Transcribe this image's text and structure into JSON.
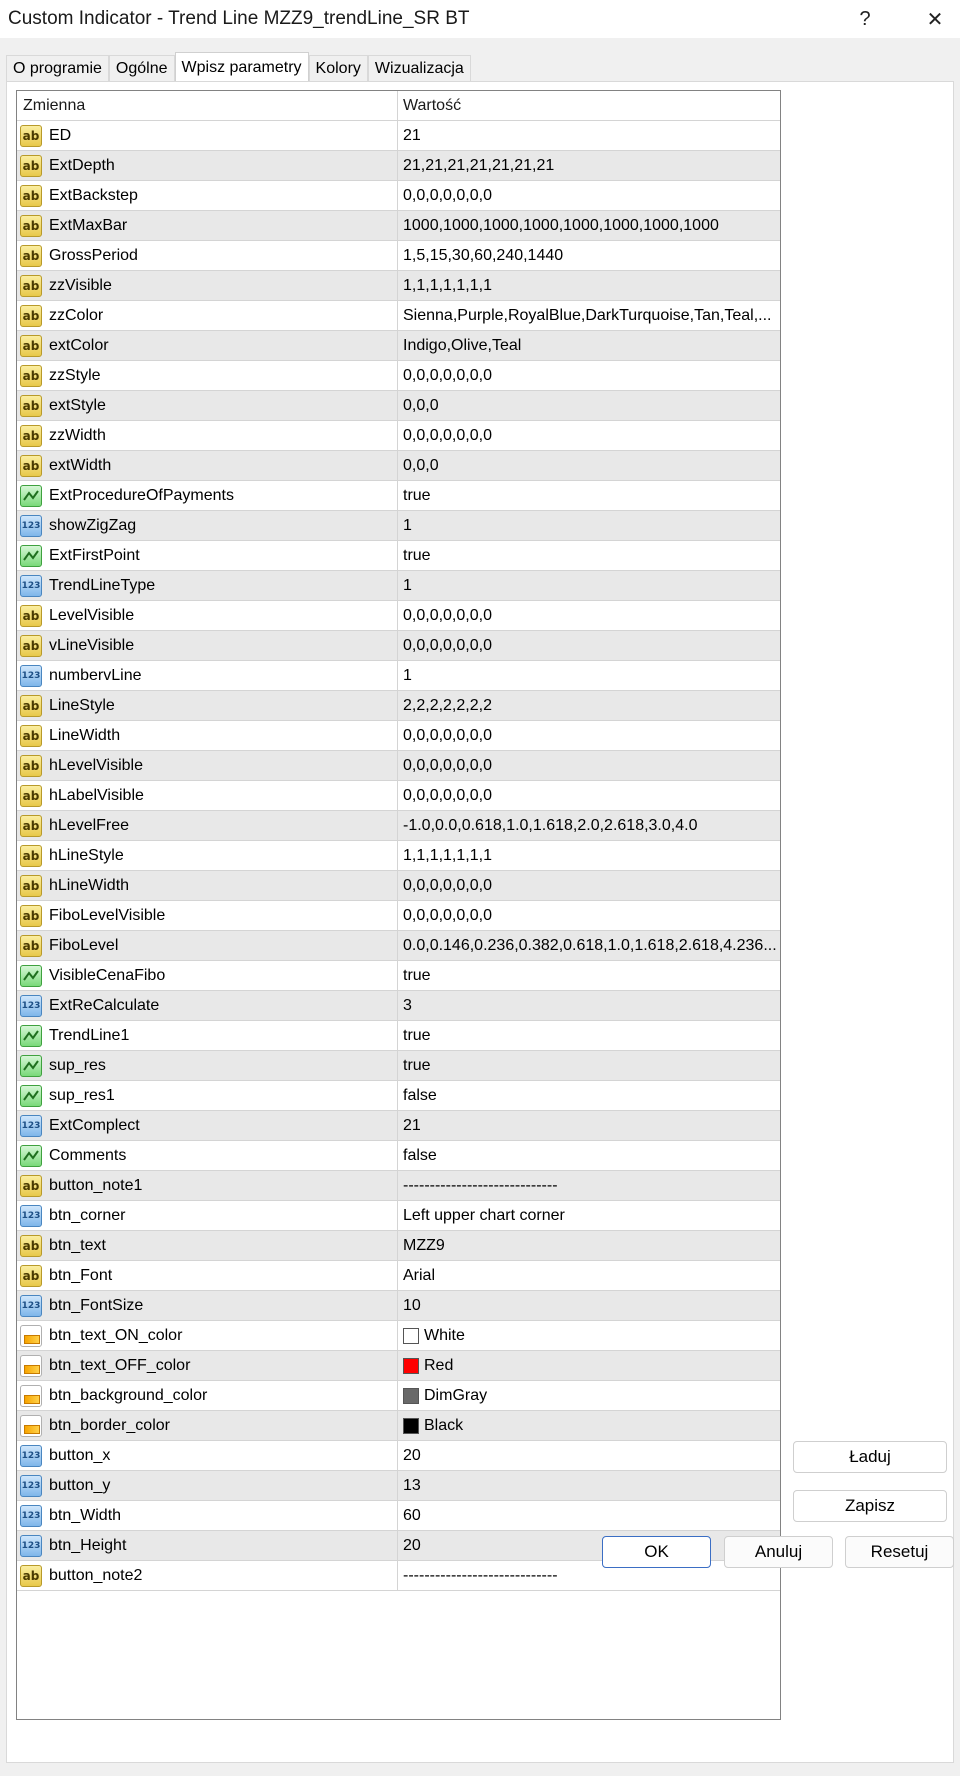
{
  "window": {
    "title": "Custom Indicator - Trend Line MZZ9_trendLine_SR BT",
    "help_glyph": "?",
    "close_glyph": "✕"
  },
  "tabs": [
    {
      "label": "O programie"
    },
    {
      "label": "Ogólne"
    },
    {
      "label": "Wpisz parametry",
      "active": true
    },
    {
      "label": "Kolory"
    },
    {
      "label": "Wizualizacja"
    }
  ],
  "grid": {
    "header": {
      "variable": "Zmienna",
      "value": "Wartość"
    },
    "rows": [
      {
        "name": "ED",
        "type": "ab",
        "value": "21"
      },
      {
        "name": "ExtDepth",
        "type": "ab",
        "value": "21,21,21,21,21,21,21"
      },
      {
        "name": "ExtBackstep",
        "type": "ab",
        "value": "0,0,0,0,0,0,0"
      },
      {
        "name": "ExtMaxBar",
        "type": "ab",
        "value": "1000,1000,1000,1000,1000,1000,1000,1000"
      },
      {
        "name": "GrossPeriod",
        "type": "ab",
        "value": "1,5,15,30,60,240,1440"
      },
      {
        "name": "zzVisible",
        "type": "ab",
        "value": "1,1,1,1,1,1,1"
      },
      {
        "name": "zzColor",
        "type": "ab",
        "value": "Sienna,Purple,RoyalBlue,DarkTurquoise,Tan,Teal,..."
      },
      {
        "name": "extColor",
        "type": "ab",
        "value": "Indigo,Olive,Teal"
      },
      {
        "name": "zzStyle",
        "type": "ab",
        "value": "0,0,0,0,0,0,0"
      },
      {
        "name": "extStyle",
        "type": "ab",
        "value": "0,0,0"
      },
      {
        "name": "zzWidth",
        "type": "ab",
        "value": "0,0,0,0,0,0,0"
      },
      {
        "name": "extWidth",
        "type": "ab",
        "value": "0,0,0"
      },
      {
        "name": "ExtProcedureOfPayments",
        "type": "bool",
        "value": "true"
      },
      {
        "name": "showZigZag",
        "type": "num",
        "value": "1"
      },
      {
        "name": "ExtFirstPoint",
        "type": "bool",
        "value": "true"
      },
      {
        "name": "TrendLineType",
        "type": "num",
        "value": "1"
      },
      {
        "name": "LevelVisible",
        "type": "ab",
        "value": "0,0,0,0,0,0,0"
      },
      {
        "name": "vLineVisible",
        "type": "ab",
        "value": "0,0,0,0,0,0,0"
      },
      {
        "name": "numbervLine",
        "type": "num",
        "value": "1"
      },
      {
        "name": "LineStyle",
        "type": "ab",
        "value": "2,2,2,2,2,2,2"
      },
      {
        "name": "LineWidth",
        "type": "ab",
        "value": "0,0,0,0,0,0,0"
      },
      {
        "name": "hLevelVisible",
        "type": "ab",
        "value": "0,0,0,0,0,0,0"
      },
      {
        "name": "hLabelVisible",
        "type": "ab",
        "value": "0,0,0,0,0,0,0"
      },
      {
        "name": "hLevelFree",
        "type": "ab",
        "value": "-1.0,0.0,0.618,1.0,1.618,2.0,2.618,3.0,4.0"
      },
      {
        "name": "hLineStyle",
        "type": "ab",
        "value": "1,1,1,1,1,1,1"
      },
      {
        "name": "hLineWidth",
        "type": "ab",
        "value": "0,0,0,0,0,0,0"
      },
      {
        "name": "FiboLevelVisible",
        "type": "ab",
        "value": "0,0,0,0,0,0,0"
      },
      {
        "name": "FiboLevel",
        "type": "ab",
        "value": "0.0,0.146,0.236,0.382,0.618,1.0,1.618,2.618,4.236..."
      },
      {
        "name": "VisibleCenaFibo",
        "type": "bool",
        "value": "true"
      },
      {
        "name": "ExtReCalculate",
        "type": "num",
        "value": "3"
      },
      {
        "name": "TrendLine1",
        "type": "bool",
        "value": "true"
      },
      {
        "name": "sup_res",
        "type": "bool",
        "value": "true"
      },
      {
        "name": "sup_res1",
        "type": "bool",
        "value": "false"
      },
      {
        "name": "ExtComplect",
        "type": "num",
        "value": "21"
      },
      {
        "name": "Comments",
        "type": "bool",
        "value": "false"
      },
      {
        "name": "button_note1",
        "type": "ab",
        "value": "-----------------------------"
      },
      {
        "name": "btn_corner",
        "type": "num",
        "value": "Left upper chart corner"
      },
      {
        "name": "btn_text",
        "type": "ab",
        "value": "MZZ9"
      },
      {
        "name": "btn_Font",
        "type": "ab",
        "value": "Arial"
      },
      {
        "name": "btn_FontSize",
        "type": "num",
        "value": "10"
      },
      {
        "name": "btn_text_ON_color",
        "type": "color",
        "value": "White",
        "swatch": "#ffffff"
      },
      {
        "name": "btn_text_OFF_color",
        "type": "color",
        "value": "Red",
        "swatch": "#ff0000"
      },
      {
        "name": "btn_background_color",
        "type": "color",
        "value": "DimGray",
        "swatch": "#696969"
      },
      {
        "name": "btn_border_color",
        "type": "color",
        "value": "Black",
        "swatch": "#000000"
      },
      {
        "name": "button_x",
        "type": "num",
        "value": "20"
      },
      {
        "name": "button_y",
        "type": "num",
        "value": "13"
      },
      {
        "name": "btn_Width",
        "type": "num",
        "value": "60"
      },
      {
        "name": "btn_Height",
        "type": "num",
        "value": "20"
      },
      {
        "name": "button_note2",
        "type": "ab",
        "value": "-----------------------------"
      }
    ]
  },
  "side_buttons": {
    "load": "Ładuj",
    "save": "Zapisz"
  },
  "footer": {
    "ok": "OK",
    "cancel": "Anuluj",
    "reset": "Resetuj"
  }
}
